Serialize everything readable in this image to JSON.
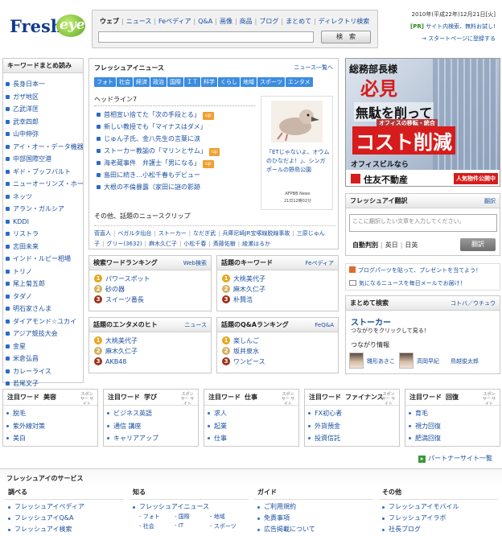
{
  "header": {
    "logo_fresh": "Fresh",
    "logo_eye": "eye",
    "search_tabs": [
      "ウェブ",
      "ニュース",
      "Feペディア",
      "Q&A",
      "画像",
      "商品",
      "ブログ",
      "まとめて",
      "ディレクトリ検索"
    ],
    "search_button": "検　索",
    "date": "2010年(平成22年)12月21日[火]",
    "pr_tag": "[PR]",
    "pr_text": "サイト内検索、無料お試し!",
    "start_page": "スタートページに登録する"
  },
  "keywords": {
    "title": "キーワードまとめ読み",
    "items": [
      "長身日本一",
      "ガザ地区",
      "乙武洋匡",
      "武幸四郎",
      "山中伸弥",
      "アイ・オー・データ機器",
      "中部国際空港",
      "ギド・ブッフバルト",
      "ニューオーリンズ・ホー",
      "ネッツ",
      "アラン・ガルシア",
      "KDDI",
      "リストラ",
      "志田未来",
      "インド・ルピー相場",
      "トリノ",
      "尾上菊五郎",
      "タダノ",
      "明石家さんま",
      "ダイアモンド☆ユカイ",
      "アジア競技大会",
      "金星",
      "米倉弘昌",
      "カレーライス",
      "若尾文子"
    ]
  },
  "news": {
    "title": "フレッシュアイニュース",
    "more": "ニュース一覧へ",
    "categories": [
      "フォト",
      "社会",
      "経済",
      "政治",
      "国際",
      "ＩＴ",
      "科学",
      "くらし",
      "地域",
      "スポーツ",
      "エンタメ"
    ],
    "headline_label": "ヘッドライン7",
    "up_label": "up",
    "headlines": [
      {
        "text": "首相宣い捨てた「次の手段とる」",
        "up": true
      },
      {
        "text": "新しい教授でも「マイナスはダメ」",
        "up": false
      },
      {
        "text": "じゅん子氏、金八先生の言葉に涙",
        "up": false
      },
      {
        "text": "ストーカー教諭の「マリンとサム」",
        "up": true
      },
      {
        "text": "海老蔵事件　弁護士「男になる」",
        "up": true
      },
      {
        "text": "島田に続き…小松千春もデビュー",
        "up": false
      },
      {
        "text": "大根の不倫暴露（家田に謎の影跡",
        "up": false
      }
    ],
    "photo_caption": "「ETじゃないよ、オウムのひなだよ！」、シンガポールの野鳥公園",
    "photo_credit": "AFPBB News",
    "photo_time": "21日12時02分",
    "clips_label": "その他、話題のニュースクリップ",
    "clips": [
      "菅直人",
      "ベガルタ仙台",
      "ストーカー",
      "なだぎ武",
      "兵庫尼崎JR宝塚線脱線事故",
      "三原じゅん子",
      "グリー(3632)",
      "麻木久仁子",
      "小松千春",
      "斎藤佑樹",
      "綾瀬はるか"
    ]
  },
  "rank1": {
    "title": "検索ワードランキング",
    "more": "Web検索",
    "items": [
      "パワースポット",
      "砂の器",
      "スイーツ番長"
    ]
  },
  "rank2": {
    "title": "話題のキーワード",
    "more": "Feペディア",
    "items": [
      "大桃美代子",
      "麻木久仁子",
      "朴贊浩"
    ]
  },
  "rank3": {
    "title": "話題のエンタメのヒト",
    "more": "ニュース",
    "items": [
      "大桃美代子",
      "麻木久仁子",
      "AKB48"
    ]
  },
  "rank4": {
    "title": "話題のQ&Aランキング",
    "more": "FeQ&A",
    "items": [
      "楽しんご",
      "坂井泉水",
      "ワンピース"
    ]
  },
  "ad": {
    "line1": "総務部長様",
    "line2": "必見",
    "line3": "無駄を削って",
    "line4": "オフィスの移転・統合",
    "line5": "コスト削減",
    "line6": "オフィスビルなら",
    "brand": "住友不動産",
    "cta": "人気物件公開中"
  },
  "translate": {
    "title": "フレッシュアイ翻訳",
    "more": "翻訳",
    "placeholder": "ここに翻訳したい文章を入力してください。",
    "modes": [
      "自動判別",
      "英日",
      "日英"
    ],
    "button": "翻訳"
  },
  "promos": [
    "ブログパーツを貼って、プレゼントを当てよう！",
    "気になるニュースを毎日メールでお届け！"
  ],
  "matome": {
    "title": "まとめて検索",
    "more": "コトバ／ウチュウ",
    "keyword": "ストーカー",
    "desc": "つながりをクリックして見る！",
    "tsunagari_label": "つながり情報",
    "people": [
      "雛形あきこ",
      "高岡早紀",
      "鳥越俊太郎"
    ]
  },
  "attention": {
    "sponsor": "スポンサー サイト",
    "cols": [
      {
        "label": "注目ワード",
        "topic": "美容",
        "items": [
          "脱毛",
          "紫外線対策",
          "美白"
        ]
      },
      {
        "label": "注目ワード",
        "topic": "学び",
        "items": [
          "ビジネス英語",
          "通信 講座",
          "キャリアアップ"
        ]
      },
      {
        "label": "注目ワード",
        "topic": "仕事",
        "items": [
          "求人",
          "起業",
          "仕事"
        ]
      },
      {
        "label": "注目ワード",
        "topic": "ファイナンス",
        "items": [
          "FX初心者",
          "外貨預金",
          "投資信託"
        ]
      },
      {
        "label": "注目ワード",
        "topic": "回復",
        "items": [
          "育毛",
          "視力回復",
          "肥満回復"
        ]
      }
    ]
  },
  "partner": "パートナーサイト一覧",
  "services": {
    "title": "フレッシュアイのサービス",
    "cols": [
      {
        "head": "調べる",
        "items": [
          "フレッシュアイペディア",
          "フレッシュアイQ&A",
          "フレッシュアイ検索"
        ]
      },
      {
        "head": "知る",
        "items": [
          "フレッシュアイニュース"
        ],
        "sub": [
          "フォト",
          "国際",
          "地域",
          "社会",
          "IT",
          "スポーツ"
        ]
      },
      {
        "head": "ガイド",
        "items": [
          "ご利用規約",
          "免責事項",
          "広告掲載について"
        ]
      },
      {
        "head": "その他",
        "items": [
          "フレッシュアイモバイル",
          "フレッシュアイラボ",
          "社長ブログ"
        ]
      }
    ]
  }
}
